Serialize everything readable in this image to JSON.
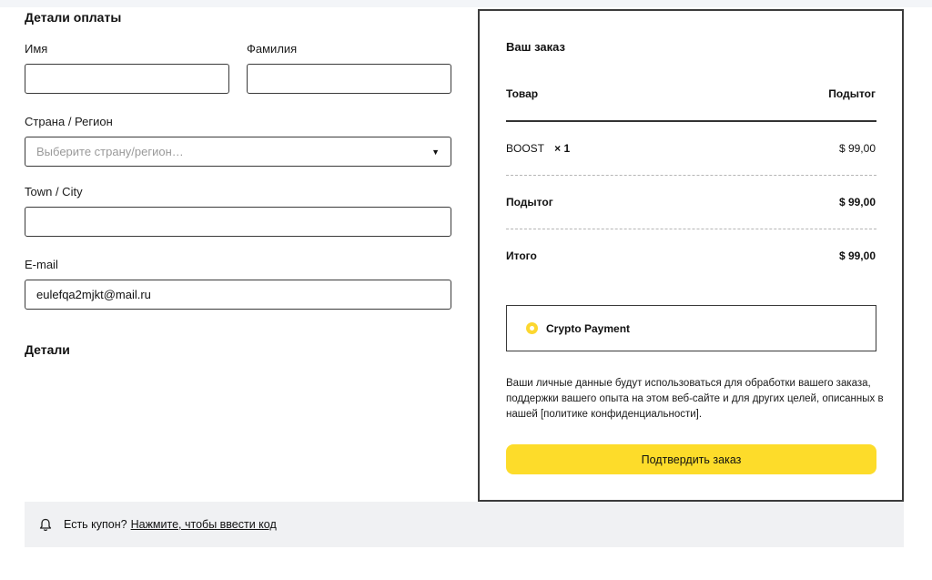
{
  "billing": {
    "title": "Детали оплаты",
    "first_name_label": "Имя",
    "first_name_value": "",
    "last_name_label": "Фамилия",
    "last_name_value": "",
    "country_label": "Страна / Регион",
    "country_placeholder": "Выберите страну/регион…",
    "town_label": "Town / City",
    "town_value": "",
    "email_label": "E-mail",
    "email_value": "eulefqa2mjkt@mail.ru"
  },
  "details": {
    "title": "Детали"
  },
  "order": {
    "title": "Ваш заказ",
    "col_product": "Товар",
    "col_subtotal": "Подытог",
    "item_name": "BOOST",
    "item_qty": "× 1",
    "item_price": "$ 99,00",
    "subtotal_label": "Подытог",
    "subtotal_value": "$ 99,00",
    "total_label": "Итого",
    "total_value": "$ 99,00",
    "payment_method": "Crypto Payment",
    "privacy_text": "Ваши личные данные будут использоваться для обработки вашего заказа, поддержки вашего опыта на этом веб-сайте и для других целей, описанных в нашей [политике конфиденциальности].",
    "confirm_label": "Подтвердить заказ"
  },
  "coupon": {
    "text": "Есть купон?",
    "link": "Нажмите, чтобы ввести код"
  },
  "icons": {
    "select_caret": "caret-down-icon",
    "coupon": "bell-icon",
    "radio": "radio-selected-icon"
  },
  "colors": {
    "accent": "#fddc2a",
    "radio": "#fcd730",
    "coupon_bg": "#f0f1f3"
  }
}
